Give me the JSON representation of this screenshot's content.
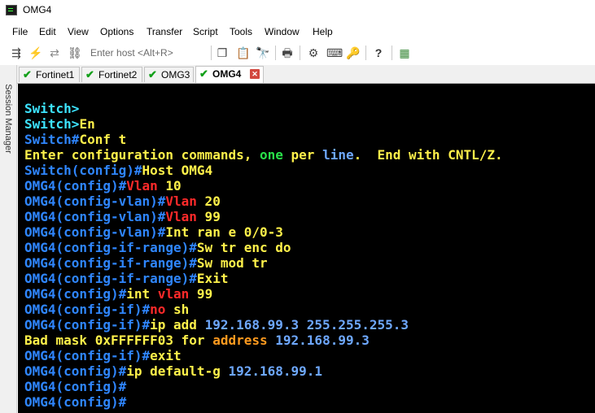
{
  "window": {
    "title": "OMG4"
  },
  "menu": [
    "File",
    "Edit",
    "View",
    "Options",
    "Transfer",
    "Script",
    "Tools",
    "Window",
    "Help"
  ],
  "toolbar": {
    "host_placeholder": "Enter host <Alt+R>"
  },
  "side_panel": {
    "label": "Session Manager"
  },
  "tabs": [
    {
      "label": "Fortinet1",
      "status": "connected"
    },
    {
      "label": "Fortinet2",
      "status": "connected"
    },
    {
      "label": "OMG3",
      "status": "connected"
    },
    {
      "label": "OMG4",
      "status": "connected",
      "active": true
    }
  ],
  "terminal": {
    "lines": [
      [
        {
          "t": "Switch>",
          "c": "cyan"
        }
      ],
      [
        {
          "t": "Switch>",
          "c": "cyan"
        },
        {
          "t": "En",
          "c": "yellow"
        }
      ],
      [
        {
          "t": "Switch#",
          "c": "blue"
        },
        {
          "t": "Conf t",
          "c": "yellow"
        }
      ],
      [
        {
          "t": "Enter configuration commands, ",
          "c": "yellow"
        },
        {
          "t": "one",
          "c": "green"
        },
        {
          "t": " per ",
          "c": "yellow"
        },
        {
          "t": "line",
          "c": "lblue"
        },
        {
          "t": ".  End with CNTL/Z.",
          "c": "yellow"
        }
      ],
      [
        {
          "t": "Switch(config)#",
          "c": "blue"
        },
        {
          "t": "Host OMG4",
          "c": "yellow"
        }
      ],
      [
        {
          "t": "OMG4(config)#",
          "c": "blue"
        },
        {
          "t": "Vlan",
          "c": "red"
        },
        {
          "t": " 10",
          "c": "yellow"
        }
      ],
      [
        {
          "t": "OMG4(config-vlan)#",
          "c": "blue"
        },
        {
          "t": "Vlan",
          "c": "red"
        },
        {
          "t": " 20",
          "c": "yellow"
        }
      ],
      [
        {
          "t": "OMG4(config-vlan)#",
          "c": "blue"
        },
        {
          "t": "Vlan",
          "c": "red"
        },
        {
          "t": " 99",
          "c": "yellow"
        }
      ],
      [
        {
          "t": "OMG4(config-vlan)#",
          "c": "blue"
        },
        {
          "t": "Int ran e 0/0-3",
          "c": "yellow"
        }
      ],
      [
        {
          "t": "OMG4(config-if-range)#",
          "c": "blue"
        },
        {
          "t": "Sw tr enc do",
          "c": "yellow"
        }
      ],
      [
        {
          "t": "OMG4(config-if-range)#",
          "c": "blue"
        },
        {
          "t": "Sw mod tr",
          "c": "yellow"
        }
      ],
      [
        {
          "t": "OMG4(config-if-range)#",
          "c": "blue"
        },
        {
          "t": "Exit",
          "c": "yellow"
        }
      ],
      [
        {
          "t": "OMG4(config)#",
          "c": "blue"
        },
        {
          "t": "int ",
          "c": "yellow"
        },
        {
          "t": "vlan",
          "c": "red"
        },
        {
          "t": " 99",
          "c": "yellow"
        }
      ],
      [
        {
          "t": "OMG4(config-if)#",
          "c": "blue"
        },
        {
          "t": "no",
          "c": "red"
        },
        {
          "t": " sh",
          "c": "yellow"
        }
      ],
      [
        {
          "t": "OMG4(config-if)#",
          "c": "blue"
        },
        {
          "t": "ip add ",
          "c": "yellow"
        },
        {
          "t": "192.168.99.3 255.255.255.3",
          "c": "lblue"
        }
      ],
      [
        {
          "t": "Bad mask 0xFFFFFF03 for ",
          "c": "yellow"
        },
        {
          "t": "address",
          "c": "orange"
        },
        {
          "t": " ",
          "c": "yellow"
        },
        {
          "t": "192.168.99.3",
          "c": "lblue"
        }
      ],
      [
        {
          "t": "OMG4(config-if)#",
          "c": "blue"
        },
        {
          "t": "exit",
          "c": "yellow"
        }
      ],
      [
        {
          "t": "OMG4(config)#",
          "c": "blue"
        },
        {
          "t": "ip default-g ",
          "c": "yellow"
        },
        {
          "t": "192.168.99.1",
          "c": "lblue"
        }
      ],
      [
        {
          "t": "OMG4(config)#",
          "c": "blue"
        }
      ],
      [
        {
          "t": "OMG4(config)#",
          "c": "blue"
        }
      ]
    ]
  }
}
